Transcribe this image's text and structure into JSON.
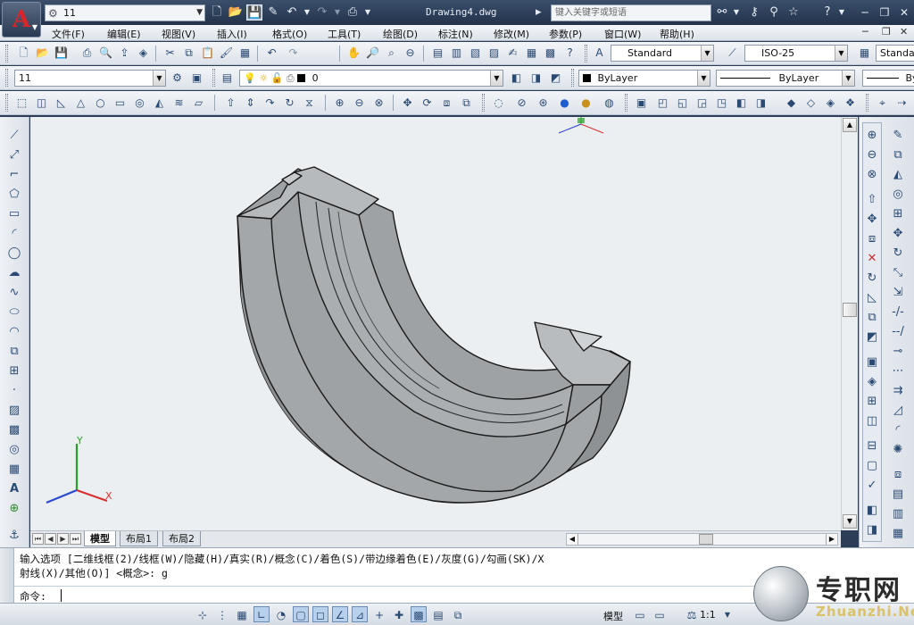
{
  "title_bar": {
    "workspace": "11",
    "document_title": "Drawing4.dwg",
    "search_placeholder": "键入关键字或短语",
    "quick_access_icons": [
      "new-file-icon",
      "open-folder-icon",
      "save-icon",
      "save-as-icon",
      "undo-icon",
      "redo-icon",
      "print-icon"
    ]
  },
  "menu": {
    "items": [
      "文件(F)",
      "编辑(E)",
      "视图(V)",
      "插入(I)",
      "格式(O)",
      "工具(T)",
      "绘图(D)",
      "标注(N)",
      "修改(M)",
      "参数(P)",
      "窗口(W)",
      "帮助(H)"
    ]
  },
  "toolbar": {
    "text_style": "Standard",
    "dim_style": "ISO-25",
    "table_style": "Standard"
  },
  "layers": {
    "layer_combo": "11",
    "current_layer": "0",
    "color": "ByLayer",
    "linetype": "ByLayer",
    "lineweight": "ByLayer"
  },
  "layout_tabs": [
    "模型",
    "布局1",
    "布局2"
  ],
  "command": {
    "history_line1": "输入选项 [二维线框(2)/线框(W)/隐藏(H)/真实(R)/概念(C)/着色(S)/带边缘着色(E)/灰度(G)/勾画(SK)/X",
    "history_line2": "射线(X)/其他(O)] <概念>: g",
    "prompt": "命令:"
  },
  "ucs": {
    "x_label": "X",
    "y_label": "Y"
  },
  "status": {
    "model_label": "模型",
    "scale": "1:1"
  },
  "watermark": {
    "brand": "专职网",
    "domain": "Zhuanzhi.Net"
  },
  "colors": {
    "title_bg": "#2c3e57",
    "canvas_bg": "#eceff1",
    "model_fill": "#a7abae",
    "accent": "#d8262b"
  }
}
